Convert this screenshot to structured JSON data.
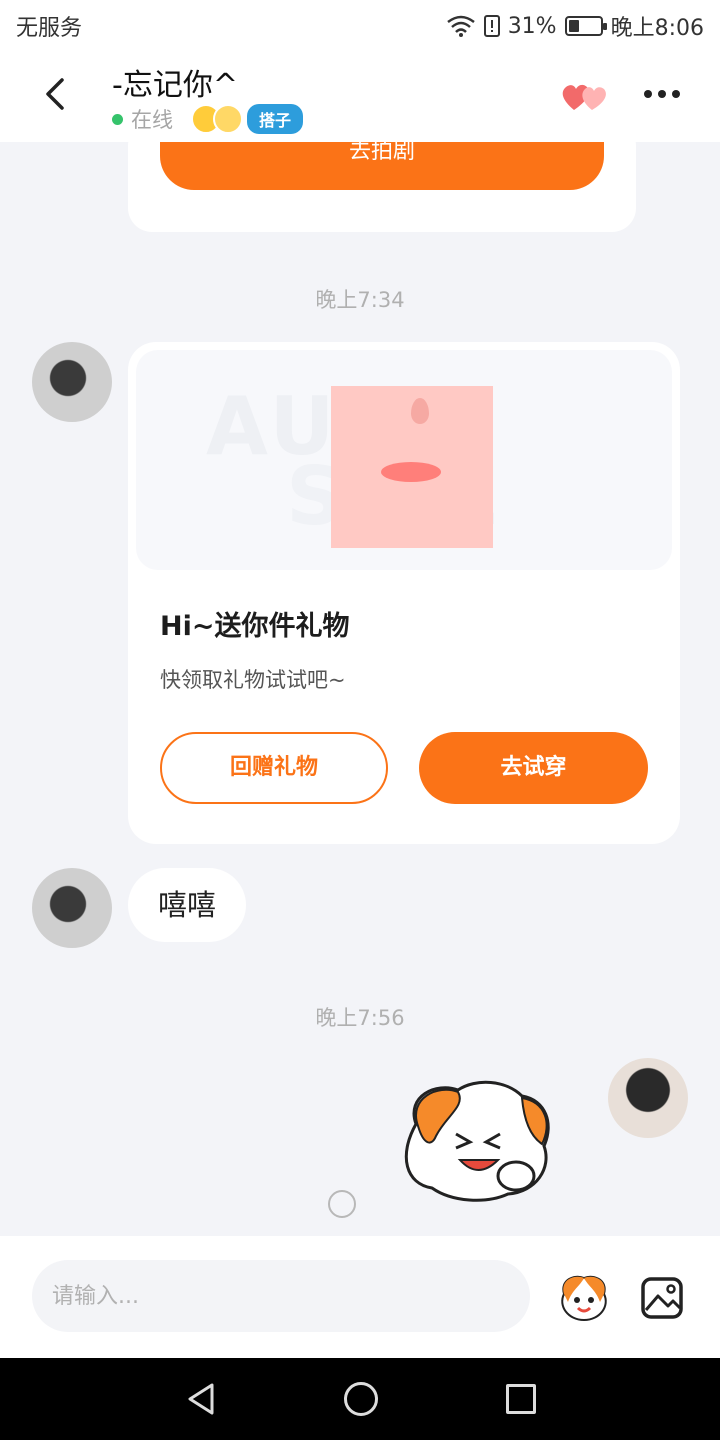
{
  "status_bar": {
    "carrier": "无服务",
    "battery": "31%",
    "time": "晚上8:06"
  },
  "header": {
    "title": "-忘记你^",
    "online_label": "在线",
    "tag_label": "搭子",
    "icons": {
      "back": "back-arrow-icon",
      "hearts": "hearts-icon",
      "more": "more-dots-icon"
    }
  },
  "messages": {
    "top_card_button": "去拍剧",
    "timestamp_1": "晚上7:34",
    "gift_card": {
      "title": "Hi~送你件礼物",
      "subtitle": "快领取礼物试试吧~",
      "return_gift_label": "回赠礼物",
      "try_on_label": "去试穿"
    },
    "text_message": "嘻嘻",
    "timestamp_2": "晚上7:56"
  },
  "composer": {
    "placeholder": "请输入...",
    "icons": {
      "mascot": "mascot-emoji-icon",
      "image": "image-icon"
    }
  },
  "colors": {
    "accent": "#fb7317",
    "online": "#35c36b",
    "tag": "#2d9ddc"
  }
}
